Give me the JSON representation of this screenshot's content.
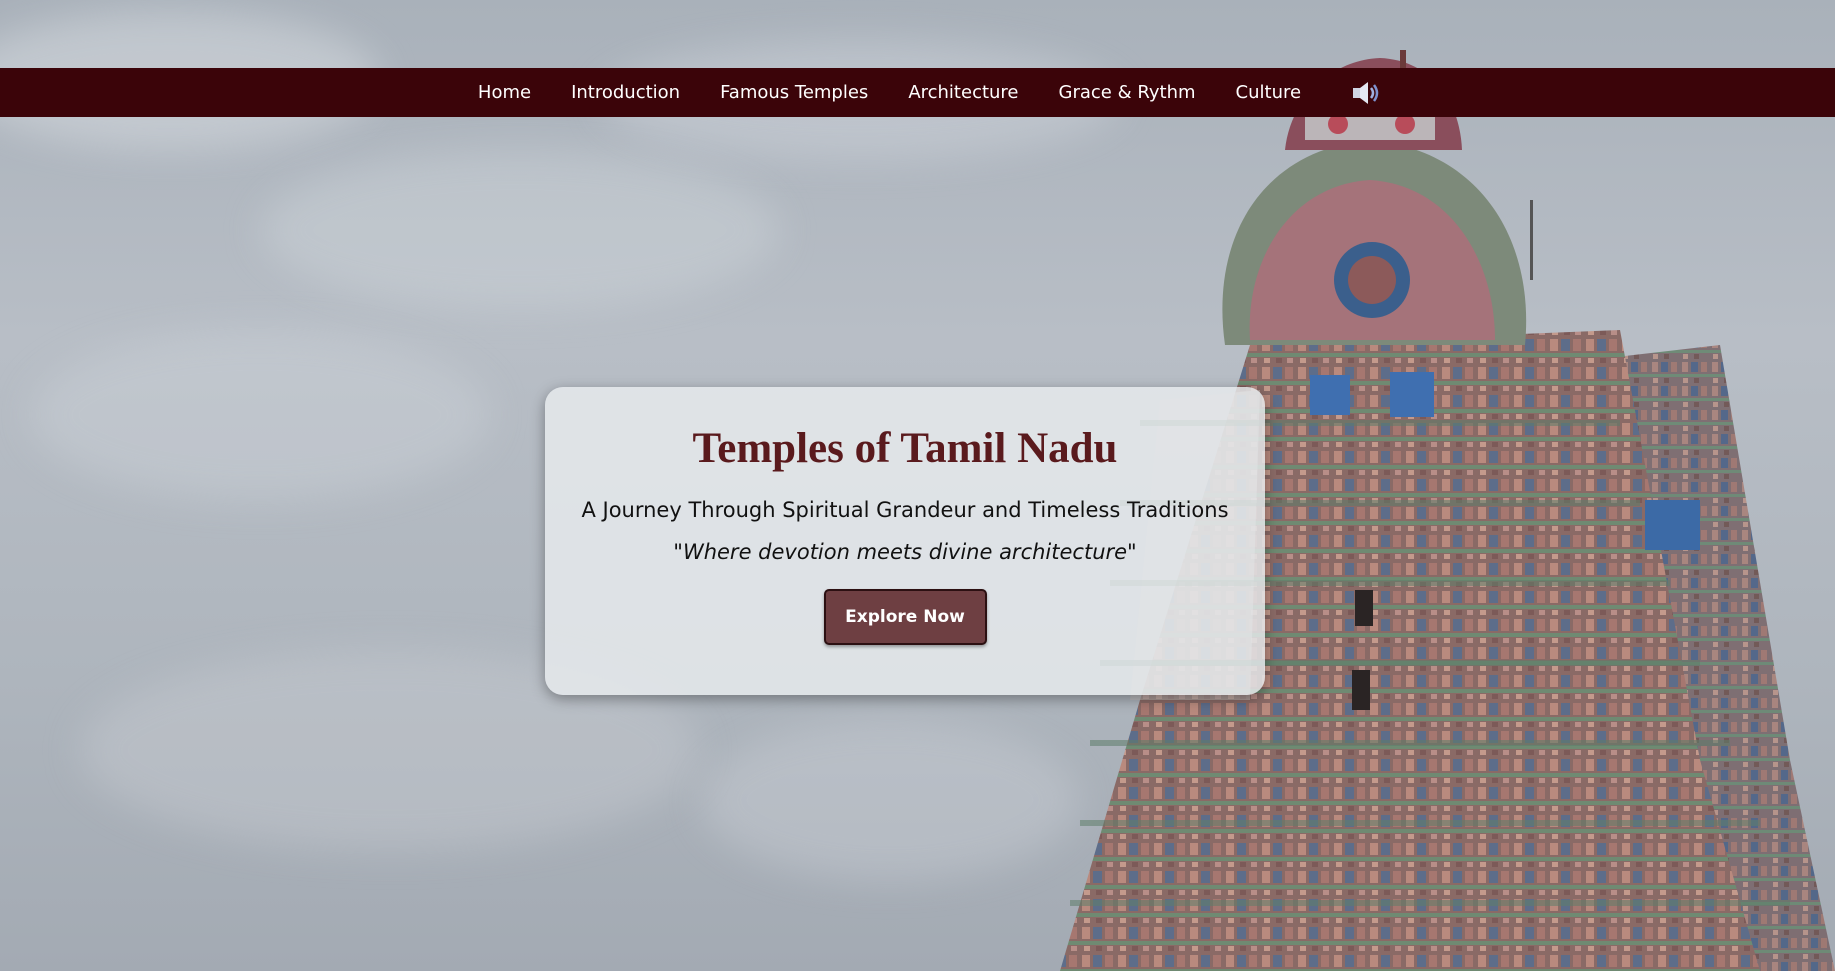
{
  "nav": {
    "items": [
      {
        "label": "Home"
      },
      {
        "label": "Introduction"
      },
      {
        "label": "Famous Temples"
      },
      {
        "label": "Architecture"
      },
      {
        "label": "Grace & Rythm"
      },
      {
        "label": "Culture"
      }
    ],
    "sound_icon": "speaker-icon"
  },
  "hero": {
    "title": "Temples of Tamil Nadu",
    "subtitle": "A Journey Through Spiritual Grandeur and Timeless Traditions",
    "quote": "\"Where devotion meets divine architecture\"",
    "cta_label": "Explore Now"
  },
  "colors": {
    "nav_background": "#3b0409",
    "title_color": "#5a1a1d",
    "button_background": "#6e3f42"
  }
}
